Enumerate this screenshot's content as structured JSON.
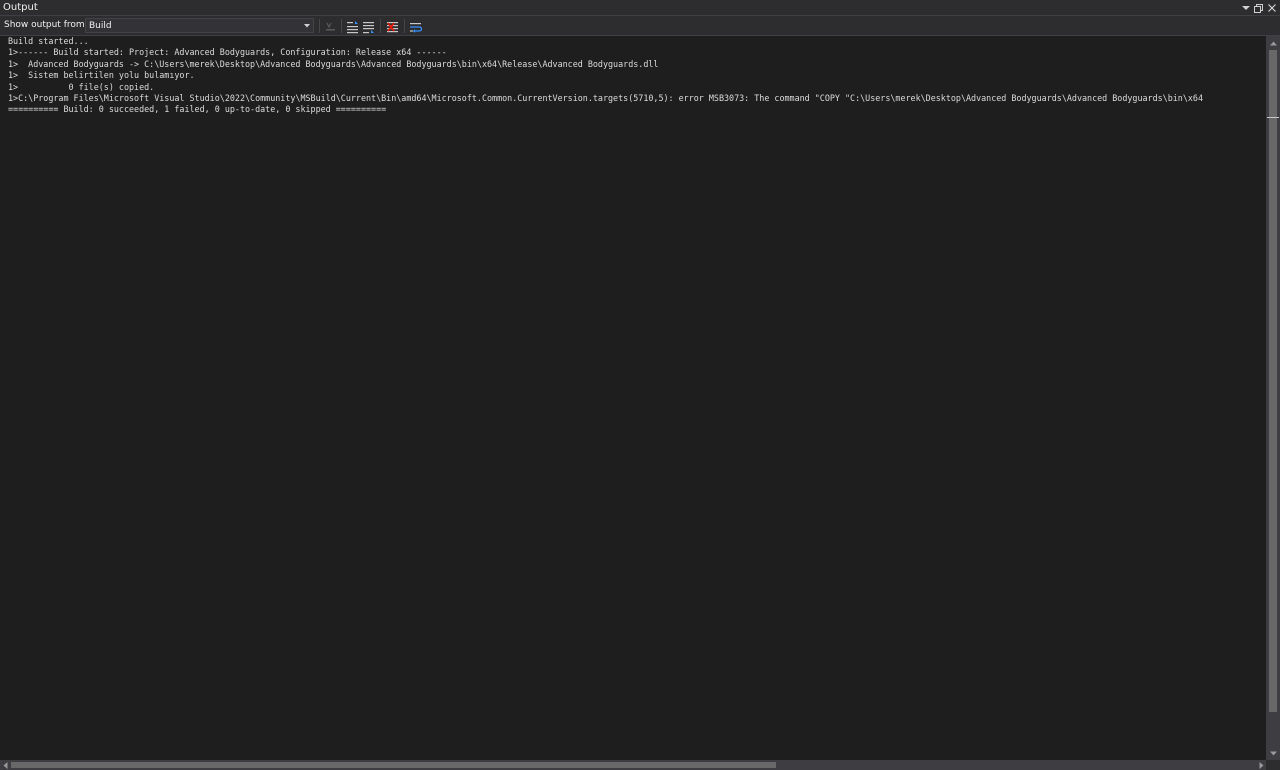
{
  "window": {
    "title": "Output",
    "controls": {
      "dropdown_icon": "chevron-down-icon",
      "restore_icon": "restore-window-icon",
      "close_icon": "close-icon"
    }
  },
  "toolbar": {
    "show_output_label": "Show output from:",
    "source_selected": "Build",
    "buttons": [
      {
        "name": "go-to-line-icon",
        "enabled": false
      },
      {
        "name": "previous-message-icon",
        "enabled": true
      },
      {
        "name": "next-message-icon",
        "enabled": true
      },
      {
        "name": "clear-all-icon",
        "enabled": true
      },
      {
        "name": "word-wrap-icon",
        "enabled": true
      }
    ]
  },
  "output": {
    "lines": [
      "Build started...",
      "1>------ Build started: Project: Advanced Bodyguards, Configuration: Release x64 ------",
      "1>  Advanced Bodyguards -> C:\\Users\\merek\\Desktop\\Advanced Bodyguards\\Advanced Bodyguards\\bin\\x64\\Release\\Advanced Bodyguards.dll",
      "1>  Sistem belirtilen yolu bulamıyor.",
      "1>          0 file(s) copied.",
      "1>C:\\Program Files\\Microsoft Visual Studio\\2022\\Community\\MSBuild\\Current\\Bin\\amd64\\Microsoft.Common.CurrentVersion.targets(5710,5): error MSB3073: The command \"COPY \"C:\\Users\\merek\\Desktop\\Advanced Bodyguards\\Advanced Bodyguards\\bin\\x64",
      "========== Build: 0 succeeded, 1 failed, 0 up-to-date, 0 skipped =========="
    ]
  },
  "colors": {
    "background": "#1e1e1e",
    "chrome": "#2d2d30",
    "text": "#dcdcdc",
    "accent": "#007acc"
  }
}
